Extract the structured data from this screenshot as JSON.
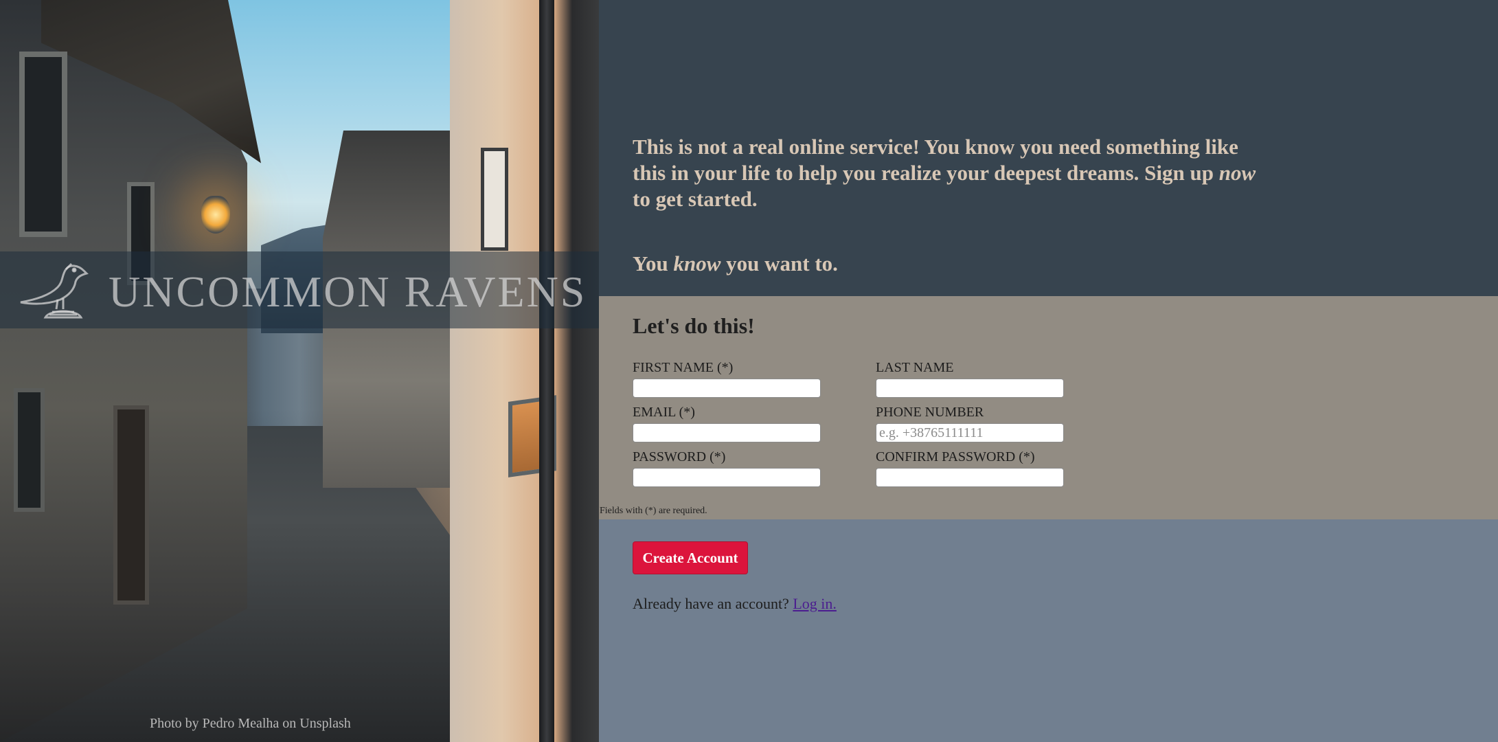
{
  "hero": {
    "brand_name": "UNCOMMON RAVENS",
    "photo_credit": "Photo by Pedro Mealha on Unsplash"
  },
  "intro": {
    "line_part1": "This is not a real online service! You know you need something like this in your life to help you realize your deepest dreams. Sign up ",
    "line_emphasis": "now",
    "line_part2": " to get started.",
    "sub_part1": "You ",
    "sub_emphasis": "know",
    "sub_part2": " you want to."
  },
  "form": {
    "title": "Let's do this!",
    "fields": {
      "first_name": {
        "label": "FIRST NAME (*)",
        "value": "",
        "placeholder": ""
      },
      "last_name": {
        "label": "LAST NAME",
        "value": "",
        "placeholder": ""
      },
      "email": {
        "label": "EMAIL (*)",
        "value": "",
        "placeholder": ""
      },
      "phone": {
        "label": "PHONE NUMBER",
        "value": "",
        "placeholder": "e.g. +38765111111"
      },
      "password": {
        "label": "PASSWORD (*)",
        "value": "",
        "placeholder": ""
      },
      "confirm_password": {
        "label": "CONFIRM PASSWORD (*)",
        "value": "",
        "placeholder": ""
      }
    },
    "required_note": "Fields with (*) are required."
  },
  "actions": {
    "create_label": "Create Account",
    "login_prompt": "Already have an account? ",
    "login_link": "Log in."
  },
  "colors": {
    "intro_bg": "#37444f",
    "intro_text": "#d8c7b5",
    "form_bg": "#928c83",
    "actions_bg": "#717f90",
    "button_bg": "#dc143c",
    "link": "#4b1d8f"
  },
  "icons": {
    "brand_logo": "raven-icon"
  }
}
